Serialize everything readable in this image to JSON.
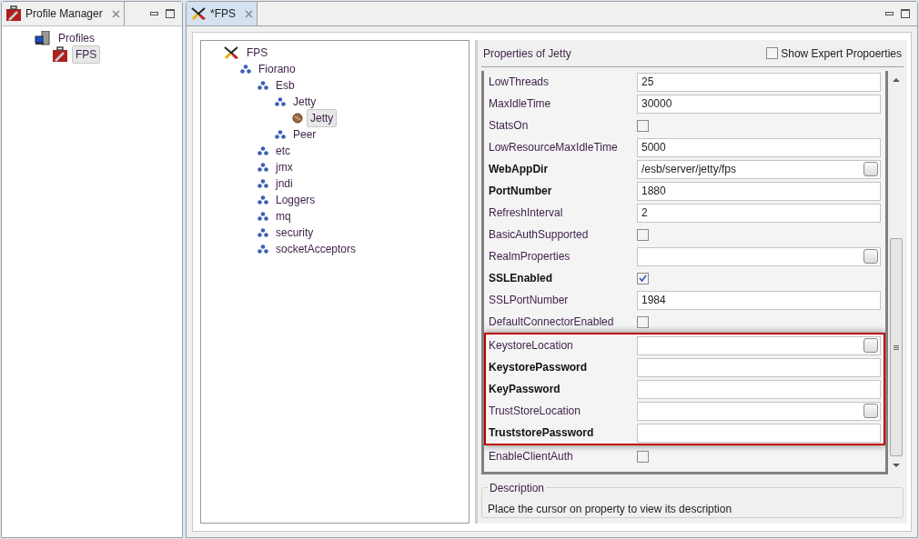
{
  "left_panel": {
    "tab": {
      "title": "Profile Manager",
      "selected": true
    },
    "tree": [
      {
        "label": "Profiles",
        "kind": "computer",
        "selected": false,
        "children": [
          {
            "label": "FPS",
            "kind": "toolbox",
            "selected": true
          }
        ]
      }
    ]
  },
  "editor": {
    "tab": {
      "title": "*FPS",
      "selected": true
    },
    "tree": [
      {
        "label": "FPS",
        "kind": "tools",
        "selected": false,
        "children": [
          {
            "label": "Fiorano",
            "kind": "node",
            "selected": false,
            "children": [
              {
                "label": "Esb",
                "kind": "node",
                "selected": false,
                "children": [
                  {
                    "label": "Jetty",
                    "kind": "node",
                    "selected": false,
                    "children": [
                      {
                        "label": "Jetty",
                        "kind": "bean",
                        "selected": true
                      }
                    ]
                  },
                  {
                    "label": "Peer",
                    "kind": "node",
                    "selected": false
                  }
                ]
              },
              {
                "label": "etc",
                "kind": "node",
                "selected": false
              },
              {
                "label": "jmx",
                "kind": "node",
                "selected": false
              },
              {
                "label": "jndi",
                "kind": "node",
                "selected": false
              },
              {
                "label": "Loggers",
                "kind": "node",
                "selected": false
              },
              {
                "label": "mq",
                "kind": "node",
                "selected": false
              },
              {
                "label": "security",
                "kind": "node",
                "selected": false
              },
              {
                "label": "socketAcceptors",
                "kind": "node",
                "selected": false
              }
            ]
          }
        ]
      }
    ]
  },
  "properties": {
    "title": "Properties of Jetty",
    "expert_toggle": {
      "label": "Show Expert Propoerties",
      "checked": false
    },
    "row_groups": [
      {
        "highlighted": false,
        "rows": [
          {
            "name": "LowThreads",
            "kind": "text",
            "value": "25",
            "required": false
          },
          {
            "name": "MaxIdleTime",
            "kind": "text",
            "value": "30000",
            "required": false
          },
          {
            "name": "StatsOn",
            "kind": "checkbox",
            "checked": false,
            "required": false
          },
          {
            "name": "LowResourceMaxIdleTime",
            "kind": "text",
            "value": "5000",
            "required": false
          },
          {
            "name": "WebAppDir",
            "kind": "browse",
            "value": "/esb/server/jetty/fps",
            "required": true
          },
          {
            "name": "PortNumber",
            "kind": "text",
            "value": "1880",
            "required": true
          },
          {
            "name": "RefreshInterval",
            "kind": "text",
            "value": "2",
            "required": false
          },
          {
            "name": "BasicAuthSupported",
            "kind": "checkbox",
            "checked": false,
            "required": false
          },
          {
            "name": "RealmProperties",
            "kind": "browse",
            "required": false
          },
          {
            "name": "SSLEnabled",
            "kind": "checkbox",
            "checked": true,
            "required": true
          },
          {
            "name": "SSLPortNumber",
            "kind": "text",
            "value": "1984",
            "required": false
          },
          {
            "name": "DefaultConnectorEnabled",
            "kind": "checkbox",
            "checked": false,
            "required": false
          }
        ]
      },
      {
        "highlighted": true,
        "rows": [
          {
            "name": "KeystoreLocation",
            "kind": "browse",
            "required": false
          },
          {
            "name": "KeystorePassword",
            "kind": "text",
            "required": true
          },
          {
            "name": "KeyPassword",
            "kind": "text",
            "required": true
          },
          {
            "name": "TrustStoreLocation",
            "kind": "browse",
            "required": false
          },
          {
            "name": "TruststorePassword",
            "kind": "text",
            "required": true
          }
        ]
      },
      {
        "highlighted": false,
        "rows": [
          {
            "name": "EnableClientAuth",
            "kind": "checkbox",
            "checked": false,
            "required": false
          }
        ]
      }
    ],
    "description": {
      "title": "Description",
      "text": "Place the cursor on property to view its description"
    }
  }
}
